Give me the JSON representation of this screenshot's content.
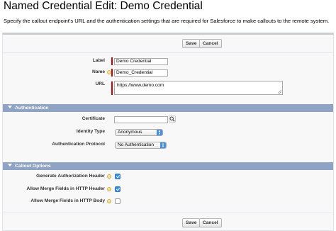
{
  "page": {
    "title": "Named Credential Edit: Demo Credential",
    "description": "Specify the callout endpoint's URL and the authentication settings that are required for Salesforce to make callouts to the remote system."
  },
  "buttons": {
    "save": "Save",
    "cancel": "Cancel"
  },
  "fields": {
    "label": {
      "label": "Label",
      "value": "Demo Credential"
    },
    "name": {
      "label": "Name",
      "value": "Demo_Credential"
    },
    "url": {
      "label": "URL",
      "value": "https://www.demo.com"
    }
  },
  "authentication": {
    "title": "Authentication",
    "certificate_label": "Certificate",
    "certificate_value": "",
    "identity_type_label": "Identity Type",
    "identity_type_value": "Anonymous",
    "auth_protocol_label": "Authentication Protocol",
    "auth_protocol_value": "No Authentication"
  },
  "callout_options": {
    "title": "Callout Options",
    "generate_auth_header": {
      "label": "Generate Authorization Header",
      "checked": true
    },
    "allow_merge_header": {
      "label": "Allow Merge Fields in HTTP Header",
      "checked": true
    },
    "allow_merge_body": {
      "label": "Allow Merge Fields in HTTP Body",
      "checked": false
    }
  },
  "colors": {
    "section_header": "#8fa3c4",
    "required": "#cc0000",
    "checkbox_checked": "#3d8fe0"
  },
  "icons": {
    "help": "info-bubble-icon",
    "lookup": "magnifier-lookup-icon",
    "select_arrow": "updown-arrows-icon"
  }
}
